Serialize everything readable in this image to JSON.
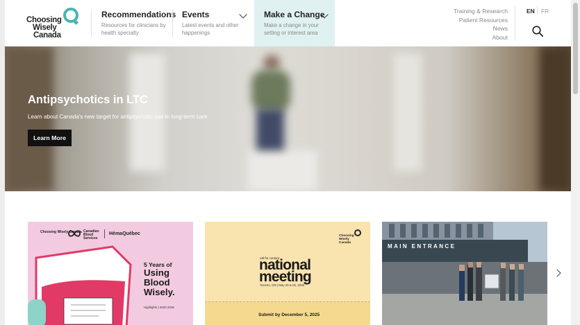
{
  "header": {
    "logo": {
      "line1": "Choosing",
      "line2": "Wisely",
      "line3": "Canada"
    },
    "nav": [
      {
        "title": "Recommendations",
        "desc": "Resources for clinicians by health specialty"
      },
      {
        "title": "Events",
        "desc": "Latest events and other happenings"
      },
      {
        "title": "Make a Change",
        "desc": "Make a change in your setting or interest area"
      }
    ],
    "secondary_links": [
      "Training & Research",
      "Patient Resources",
      "News",
      "About"
    ],
    "lang": {
      "en": "EN",
      "fr": "FR"
    }
  },
  "hero": {
    "title": "Antipsychotics in LTC",
    "subtitle": "Learn about Canada's new target for antipsychotic use in long-term care.",
    "cta": "Learn More"
  },
  "cards": {
    "card1": {
      "logos": [
        "Choosing Wisely Canada",
        "Canadian Blood Services",
        "HémaQuébec"
      ],
      "title_small": "5 Years of",
      "title_big": [
        "Using",
        "Blood",
        "Wisely."
      ],
      "sub": "Highlights | 2020-2025"
    },
    "card2": {
      "logo": "Choosing Wisely Canada",
      "small": "call for content",
      "big": [
        "national",
        "meeting"
      ],
      "date": "Toronto, ON | May 25 & 26, 2026",
      "cta": "Submit by December 5, 2025"
    },
    "card3": {
      "sign": "MAIN ENTRANCE"
    }
  },
  "colors": {
    "brand_teal": "#45b6b0",
    "active_nav_bg": "#dff2f1",
    "blood_red": "#e23a66"
  }
}
